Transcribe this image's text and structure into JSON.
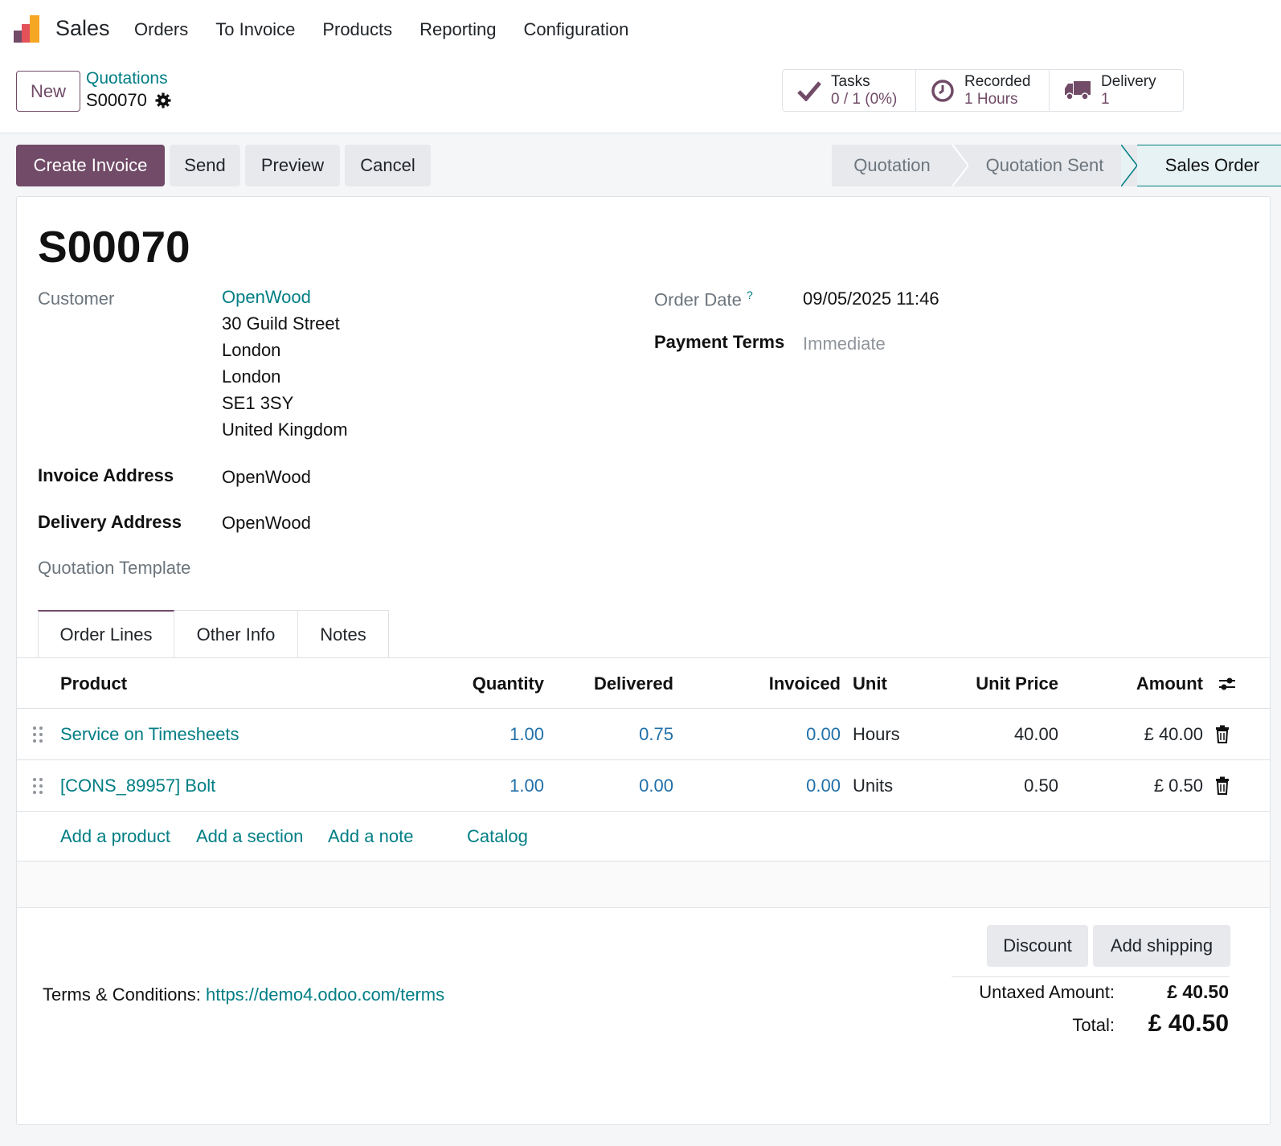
{
  "app": {
    "name": "Sales"
  },
  "menu": [
    "Orders",
    "To Invoice",
    "Products",
    "Reporting",
    "Configuration"
  ],
  "control": {
    "new_label": "New",
    "breadcrumb_parent": "Quotations",
    "breadcrumb_current": "S00070",
    "smart_buttons": [
      {
        "label": "Tasks",
        "value": "0 / 1 (0%)",
        "icon": "check-icon"
      },
      {
        "label": "Recorded",
        "value": "1 Hours",
        "icon": "clock-icon"
      },
      {
        "label": "Delivery",
        "value": "1",
        "icon": "truck-icon"
      }
    ]
  },
  "actions": {
    "create_invoice": "Create Invoice",
    "send": "Send",
    "preview": "Preview",
    "cancel": "Cancel"
  },
  "stages": {
    "items": [
      "Quotation",
      "Quotation Sent",
      "Sales Order"
    ],
    "active": "Sales Order"
  },
  "form": {
    "title": "S00070",
    "customer_label": "Customer",
    "customer_name": "OpenWood",
    "customer_address": [
      "30 Guild Street",
      "London",
      "London",
      "SE1 3SY",
      "United Kingdom"
    ],
    "invoice_address_label": "Invoice Address",
    "invoice_address": "OpenWood",
    "delivery_address_label": "Delivery Address",
    "delivery_address": "OpenWood",
    "quotation_template_label": "Quotation Template",
    "order_date_label": "Order Date",
    "order_date_help": "?",
    "order_date": "09/05/2025 11:46",
    "payment_terms_label": "Payment Terms",
    "payment_terms_placeholder": "Immediate"
  },
  "tabs": [
    "Order Lines",
    "Other Info",
    "Notes"
  ],
  "table": {
    "headers": {
      "product": "Product",
      "quantity": "Quantity",
      "delivered": "Delivered",
      "invoiced": "Invoiced",
      "unit": "Unit",
      "unit_price": "Unit Price",
      "amount": "Amount"
    },
    "rows": [
      {
        "product": "Service on Timesheets",
        "quantity": "1.00",
        "delivered": "0.75",
        "invoiced": "0.00",
        "unit": "Hours",
        "unit_price": "40.00",
        "amount": "£ 40.00"
      },
      {
        "product": "[CONS_89957] Bolt",
        "quantity": "1.00",
        "delivered": "0.00",
        "invoiced": "0.00",
        "unit": "Units",
        "unit_price": "0.50",
        "amount": "£ 0.50"
      }
    ],
    "add_links": {
      "product": "Add a product",
      "section": "Add a section",
      "note": "Add a note",
      "catalog": "Catalog"
    }
  },
  "footer": {
    "discount": "Discount",
    "add_shipping": "Add shipping",
    "terms_label": "Terms & Conditions:",
    "terms_link": "https://demo4.odoo.com/terms",
    "untaxed_label": "Untaxed Amount:",
    "untaxed_value": "£ 40.50",
    "total_label": "Total:",
    "total_value": "£ 40.50"
  },
  "colors": {
    "brand": "#714b67",
    "link": "#017e84",
    "number_link": "#1f6fa8"
  }
}
